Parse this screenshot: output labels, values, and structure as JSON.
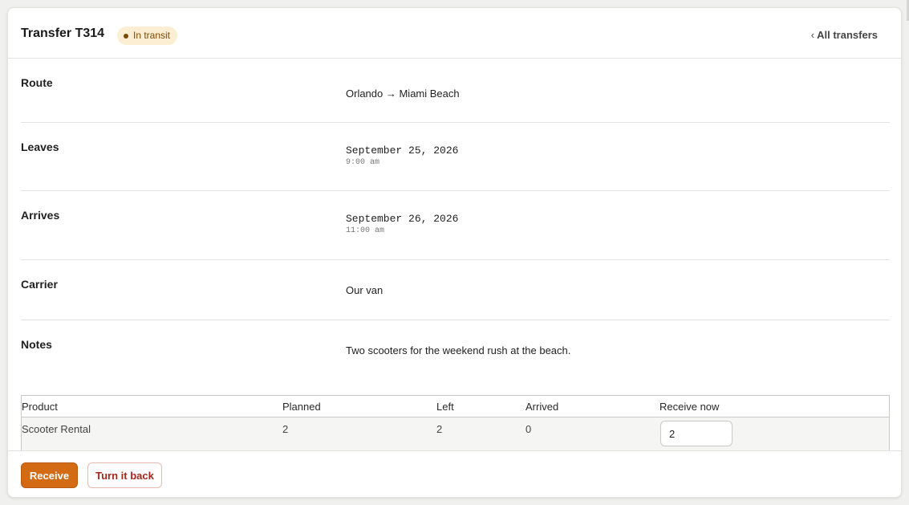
{
  "header": {
    "title": "Transfer T314",
    "status_badge": "In transit",
    "back_link_chevron": "‹",
    "back_link_label": "All transfers"
  },
  "details": {
    "route": {
      "label": "Route",
      "value": "Orlando → Miami Beach"
    },
    "leaves": {
      "label": "Leaves",
      "date": "September 25, 2026",
      "time": "9:00 am"
    },
    "arrives": {
      "label": "Arrives",
      "date": "September 26, 2026",
      "time": "11:00 am"
    },
    "carrier": {
      "label": "Carrier",
      "value": "Our van"
    },
    "notes": {
      "label": "Notes",
      "value": "Two scooters for the weekend rush at the beach."
    }
  },
  "table": {
    "columns": [
      "Product",
      "Planned",
      "Left",
      "Arrived",
      "Receive now"
    ],
    "rows": [
      {
        "product": "Scooter Rental",
        "planned": "2",
        "left": "2",
        "arrived": "0",
        "receive_now": "2"
      }
    ]
  },
  "actions": {
    "receive_label": "Receive",
    "return_label": "Turn it back"
  },
  "colors": {
    "primary": "#d36a14",
    "danger_text": "#a4281b",
    "badge_bg": "#fbeed2",
    "badge_text": "#7a4a05"
  }
}
